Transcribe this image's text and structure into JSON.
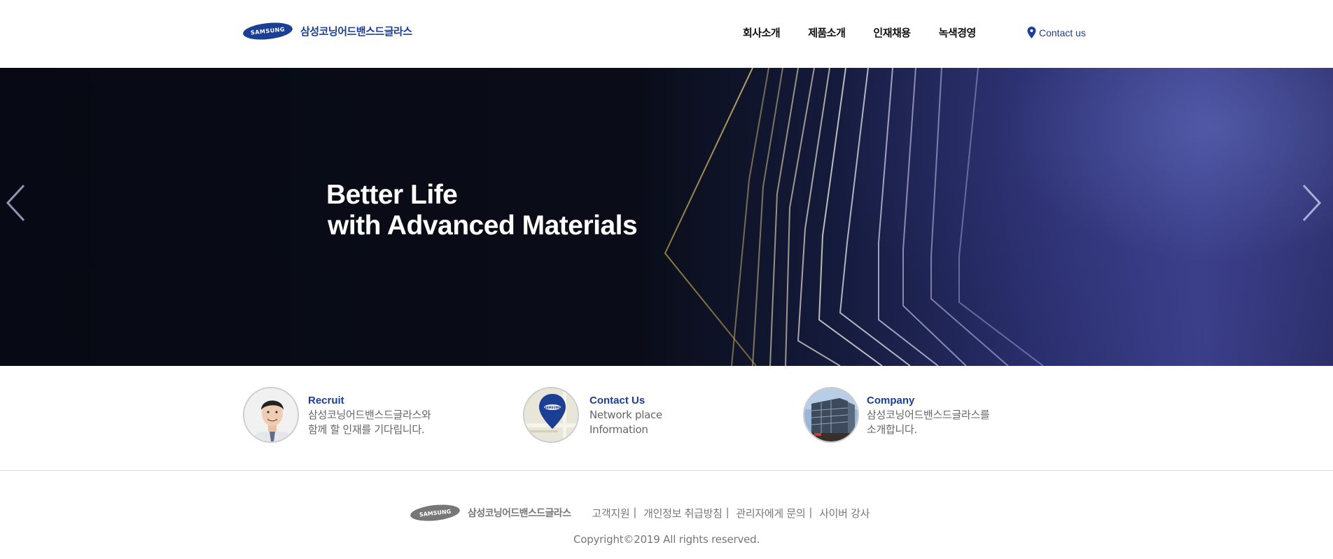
{
  "header": {
    "brand_mark": "SAMSUNG",
    "brand_name": "삼성코닝어드밴스드글라스",
    "nav": [
      {
        "label": "회사소개"
      },
      {
        "label": "제품소개"
      },
      {
        "label": "인재채용"
      },
      {
        "label": "녹색경영"
      }
    ],
    "contact_label": "Contact us",
    "contact_icon": "map-pin-icon"
  },
  "hero": {
    "title_line1": "Better Life",
    "title_line2": "with Advanced Materials",
    "prev_icon": "chevron-left-icon",
    "next_icon": "chevron-right-icon"
  },
  "quick_links": [
    {
      "title": "Recruit",
      "desc_line1": "삼성코닝어드밴스드글라스와",
      "desc_line2": "함께 할 인재를 기다립니다."
    },
    {
      "title": "Contact Us",
      "desc_line1": "Network place",
      "desc_line2": "Information"
    },
    {
      "title": "Company",
      "desc_line1": "삼성코닝어드밴스드글라스를",
      "desc_line2": "소개합니다."
    }
  ],
  "footer": {
    "brand_mark": "SAMSUNG",
    "brand_name": "삼성코닝어드밴스드글라스",
    "links": [
      {
        "label": "고객지원"
      },
      {
        "label": "개인정보 취급방침"
      },
      {
        "label": "관리자에게 문의"
      },
      {
        "label": "사이버 강사"
      }
    ],
    "separator": "|",
    "copyright": "Copyright©2019 All rights reserved."
  },
  "colors": {
    "brand_blue": "#1b3f94",
    "hero_dark": "#070a14",
    "hero_purple": "#3b3f8a",
    "footer_gray": "#777777"
  }
}
